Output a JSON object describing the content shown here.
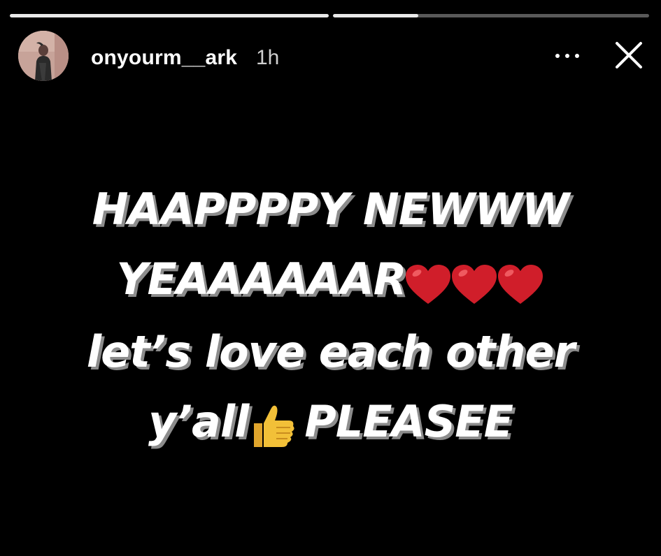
{
  "story": {
    "progress": [
      1.0,
      0.27
    ],
    "user": {
      "username": "onyourm__ark",
      "time_ago": "1h",
      "avatar_icon": "profile-photo"
    },
    "actions": {
      "more_icon": "ellipsis-icon",
      "close_icon": "close-icon"
    },
    "text_lines": [
      "HAAPPPPY NEWWW",
      "YEAAAAAAR",
      "let’s love each other",
      "y’all",
      "PLEASEE"
    ],
    "emojis": {
      "hearts": "❤️❤️❤️",
      "thumb": "👍"
    },
    "colors": {
      "background": "#000000",
      "text": "#ffffff",
      "text_shadow": "#8c8c8c",
      "heart": "#d01e2a",
      "thumb": "#f2c038"
    }
  }
}
